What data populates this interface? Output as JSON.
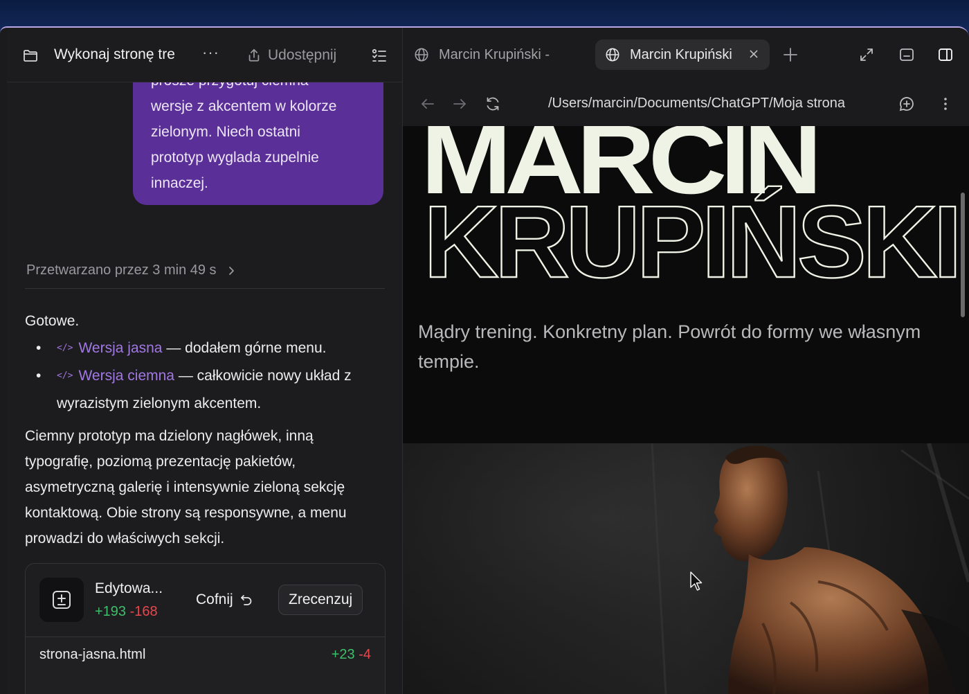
{
  "sidebar": {
    "title": "Wykonaj stronę tre",
    "more_label": "···",
    "share_label": "Udostępnij"
  },
  "chat": {
    "user_bubble_lines": [
      "prosze przygotuj ciemna",
      "wersje z akcentem w kolorze",
      "zielonym. Niech ostatni",
      "prototyp wyglada zupelnie",
      "innaczej."
    ],
    "processed_label": "Przetwarzano przez 3 min 49 s",
    "reply": {
      "intro": "Gotowe.",
      "items": [
        {
          "link": "Wersja jasna",
          "text": " — dodałem górne menu."
        },
        {
          "link": "Wersja ciemna",
          "text": " — całkowicie nowy układ z wyrazistym zielonym akcentem."
        }
      ],
      "paragraph": "Ciemny prototyp ma dzielony nagłówek, inną typografię, poziomą prezentację pakietów, asymetryczną galerię i intensywnie zieloną sekcję kontaktową. Obie strony są responsywne, a menu prowadzi do właściwych sekcji."
    },
    "edit_card": {
      "title": "Edytowa...",
      "added": "+193",
      "removed": "-168",
      "undo_label": "Cofnij",
      "review_label": "Zrecenzuj",
      "files": [
        {
          "name": "strona-jasna.html",
          "added": "+23",
          "removed": "-4"
        }
      ]
    }
  },
  "browser": {
    "tabs": [
      {
        "label": "Marcin Krupiński -"
      },
      {
        "label": "Marcin Krupiński",
        "close_icon": "close-icon"
      }
    ],
    "url": "/Users/marcin/Documents/ChatGPT/Moja strona",
    "page": {
      "hero_line_1": "MARCIN",
      "hero_line_2": "KRUPIŃSKI",
      "tagline": "Mądry trening. Konkretny plan. Powrót do formy we własnym tempie."
    }
  },
  "colors": {
    "accent_purple": "#5a2f97",
    "link_purple": "#a178e3",
    "diff_green": "#3ebf6b",
    "diff_red": "#e5484d",
    "hero_text": "#eef3e6"
  }
}
